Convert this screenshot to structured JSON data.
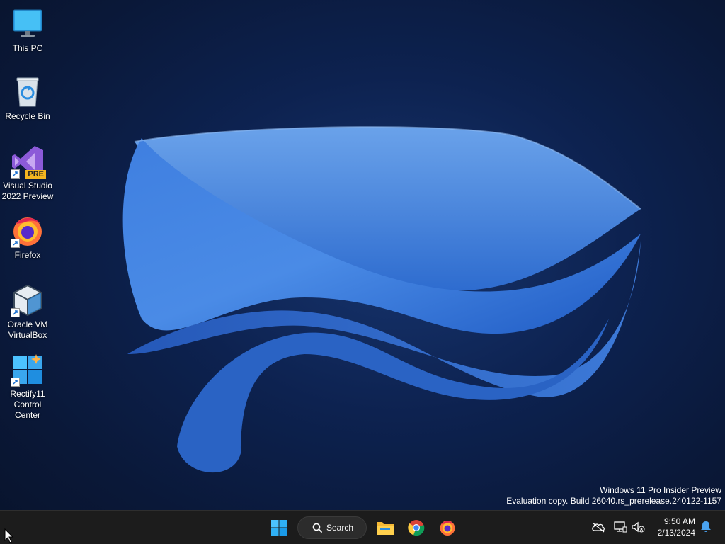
{
  "desktop": {
    "icons": [
      {
        "label_lines": [
          "This PC"
        ],
        "icon": "monitor-icon"
      },
      {
        "label_lines": [
          "Recycle Bin"
        ],
        "icon": "recycle-bin-icon"
      },
      {
        "label_lines": [
          "Visual Studio",
          "2022 Preview"
        ],
        "icon": "visual-studio-icon",
        "badge": "PRE"
      },
      {
        "label_lines": [
          "Firefox"
        ],
        "icon": "firefox-icon"
      },
      {
        "label_lines": [
          "Oracle VM",
          "VirtualBox"
        ],
        "icon": "virtualbox-icon"
      },
      {
        "label_lines": [
          "Rectify11",
          "Control",
          "Center"
        ],
        "icon": "rectify11-icon"
      }
    ]
  },
  "watermark": {
    "line1": "Windows 11 Pro Insider Preview",
    "line2": "Evaluation copy. Build 26040.rs_prerelease.240122-1157"
  },
  "taskbar": {
    "search_label": "Search",
    "pinned": [
      "start-button",
      "file-explorer",
      "chrome",
      "firefox"
    ],
    "clock": {
      "time": "9:50 AM",
      "date": "2/13/2024"
    },
    "tray_icons": [
      "onedrive-icon",
      "network-icon",
      "volume-muted-icon",
      "notification-bell-icon"
    ]
  },
  "colors": {
    "taskbar": "#1c1c1c",
    "accent": "#3b82f6",
    "wallpaper": "#0d2250"
  }
}
